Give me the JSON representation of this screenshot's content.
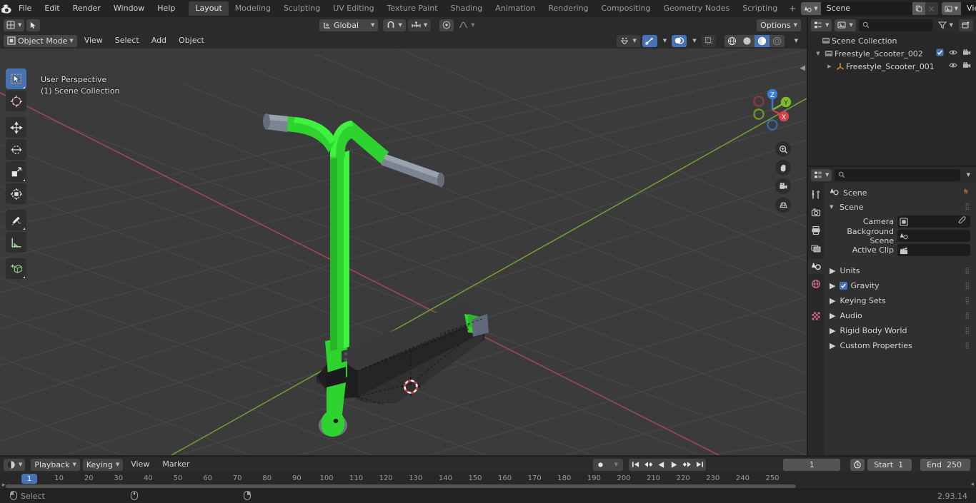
{
  "app": {
    "version": "2.93.14"
  },
  "topbar": {
    "logo_icon": "blender-logo-icon",
    "menus": [
      "File",
      "Edit",
      "Render",
      "Window",
      "Help"
    ],
    "workspaces": [
      {
        "label": "Layout",
        "active": true
      },
      {
        "label": "Modeling",
        "active": false
      },
      {
        "label": "Sculpting",
        "active": false
      },
      {
        "label": "UV Editing",
        "active": false
      },
      {
        "label": "Texture Paint",
        "active": false
      },
      {
        "label": "Shading",
        "active": false
      },
      {
        "label": "Animation",
        "active": false
      },
      {
        "label": "Rendering",
        "active": false
      },
      {
        "label": "Compositing",
        "active": false
      },
      {
        "label": "Geometry Nodes",
        "active": false
      },
      {
        "label": "Scripting",
        "active": false
      }
    ],
    "add_workspace_label": "+",
    "scene": {
      "name": "Scene",
      "icon": "scene-icon",
      "new_icon": "duplicate-icon",
      "unlink_icon": "x-icon"
    },
    "view_layer": {
      "name": "View Layer",
      "icon": "view-layer-icon",
      "new_icon": "duplicate-icon",
      "unlink_icon": "x-icon"
    }
  },
  "viewport": {
    "mode": "Object Mode",
    "mode_icon": "object-mode-icon",
    "menus": [
      "View",
      "Select",
      "Add",
      "Object"
    ],
    "transform_orientation": "Global",
    "transform_icon": "orientation-icon",
    "snap_icon": "magnet-icon",
    "snap_target_icon": "snap-increment-icon",
    "proportional_icon": "proportional-editing-icon",
    "proportional_falloff_icon": "falloff-curve-icon",
    "options_label": "Options",
    "visibility_icon": "object-types-visibility-icon",
    "gizmo_icon": "gizmo-icon",
    "overlays_icon": "overlays-icon",
    "xray_icon": "xray-icon",
    "shading_modes": [
      {
        "name": "wireframe-shading-icon",
        "active": false
      },
      {
        "name": "solid-shading-icon",
        "active": false
      },
      {
        "name": "material-preview-shading-icon",
        "active": true
      },
      {
        "name": "rendered-shading-icon",
        "active": false
      }
    ],
    "overlay_line1": "User Perspective",
    "overlay_line2": "(1) Scene Collection",
    "toolbar": [
      {
        "name": "tweak-select-box-tool",
        "active": true,
        "group": 0
      },
      {
        "name": "cursor-tool",
        "active": false,
        "group": 0
      },
      {
        "name": "move-tool",
        "active": false,
        "group": 1
      },
      {
        "name": "rotate-tool",
        "active": false,
        "group": 1
      },
      {
        "name": "scale-tool",
        "active": false,
        "group": 1
      },
      {
        "name": "transform-tool",
        "active": false,
        "group": 1
      },
      {
        "name": "annotate-tool",
        "active": false,
        "group": 2
      },
      {
        "name": "measure-tool",
        "active": false,
        "group": 2
      },
      {
        "name": "add-cube-tool",
        "active": false,
        "group": 3
      }
    ],
    "gizmo_axes": [
      {
        "label": "Z",
        "color": "#3b7ed0"
      },
      {
        "label": "Y",
        "color": "#7dbd2c"
      },
      {
        "label": "X",
        "color": "#d6414e"
      }
    ],
    "nav_buttons": [
      "zoom-icon",
      "pan-hand-icon",
      "camera-view-icon",
      "toggle-orthographic-icon"
    ],
    "model": {
      "name": "freestyle-scooter-model",
      "accent_color": "#2fd32f",
      "dark_color": "#2a2a2c",
      "metal_color": "#7c8492"
    },
    "colors": {
      "background": "#3b3b3b",
      "grid": "#4b4b4b",
      "x_axis": "#9c4a50",
      "y_axis": "#6e9c35"
    }
  },
  "outliner": {
    "display_mode_icon": "editor-type-icon",
    "filter_scene_icon": "view-layer-icon",
    "search_placeholder": "",
    "filter_icon": "filter-icon",
    "new_collection_icon": "new-collection-icon",
    "rows": [
      {
        "label": "Scene Collection",
        "indent": 0,
        "icon": "collection-icon",
        "triangle": "",
        "checkbox": false,
        "eye": false,
        "camera": false
      },
      {
        "label": "Freestyle_Scooter_002",
        "indent": 1,
        "icon": "collection-icon",
        "triangle": "down",
        "checkbox": true,
        "eye": true,
        "camera": true
      },
      {
        "label": "Freestyle_Scooter_001",
        "indent": 2,
        "icon": "empty-axes-icon",
        "triangle": "right",
        "checkbox": false,
        "eye": true,
        "camera": true
      }
    ]
  },
  "properties": {
    "editor_icon": "properties-editor-icon",
    "search_placeholder": "",
    "tabs": [
      {
        "name": "tool-tab",
        "icon": "tool-icon",
        "active": false
      },
      {
        "name": "render-tab",
        "icon": "render-camera-icon",
        "active": false
      },
      {
        "name": "output-tab",
        "icon": "printer-icon",
        "active": false
      },
      {
        "name": "view-layer-tab",
        "icon": "images-icon",
        "active": false
      },
      {
        "name": "scene-tab",
        "icon": "scene-cone-icon",
        "active": true
      },
      {
        "name": "world-tab",
        "icon": "world-globe-icon",
        "active": false
      },
      {
        "name": "texture-tab",
        "icon": "checker-texture-icon",
        "active": false
      }
    ],
    "breadcrumb": {
      "icon": "scene-cone-icon",
      "label": "Scene",
      "pin_icon": "pin-icon"
    },
    "scene_panel": {
      "title": "Scene",
      "fields": [
        {
          "label": "Camera",
          "value": "",
          "icon": "camera-data-icon",
          "has_eyedropper": true
        },
        {
          "label": "Background Scene",
          "value": "",
          "icon": "scene-cone-icon",
          "has_eyedropper": false
        },
        {
          "label": "Active Clip",
          "value": "",
          "icon": "movie-clip-icon",
          "has_eyedropper": false
        }
      ]
    },
    "panels": [
      {
        "label": "Units",
        "checkbox": null
      },
      {
        "label": "Gravity",
        "checkbox": true
      },
      {
        "label": "Keying Sets",
        "checkbox": null
      },
      {
        "label": "Audio",
        "checkbox": null
      },
      {
        "label": "Rigid Body World",
        "checkbox": null
      },
      {
        "label": "Custom Properties",
        "checkbox": null
      }
    ]
  },
  "timeline": {
    "editor_icon": "timeline-editor-icon",
    "menus": [
      "Playback",
      "Keying",
      "View",
      "Marker"
    ],
    "record_icon": "record-icon",
    "playback_buttons": [
      "jump-to-start-icon",
      "previous-keyframe-icon",
      "play-reverse-icon",
      "play-icon",
      "next-keyframe-icon",
      "jump-to-end-icon"
    ],
    "current_frame": "1",
    "auto_key_icon": "auto-keying-icon",
    "start_label": "Start",
    "start_value": "1",
    "end_label": "End",
    "end_value": "250",
    "ruler_ticks": [
      "10",
      "20",
      "30",
      "40",
      "50",
      "60",
      "70",
      "80",
      "90",
      "100",
      "110",
      "120",
      "130",
      "140",
      "150",
      "160",
      "170",
      "180",
      "190",
      "200",
      "210",
      "220",
      "230",
      "240",
      "250"
    ],
    "playhead_label": "1"
  },
  "status": {
    "mouse_left_icon": "mouse-left-icon",
    "select_label": "Select",
    "mouse_middle_icon": "mouse-middle-icon",
    "mouse_right_icon": "mouse-right-icon",
    "version_label": "2.93.14"
  }
}
